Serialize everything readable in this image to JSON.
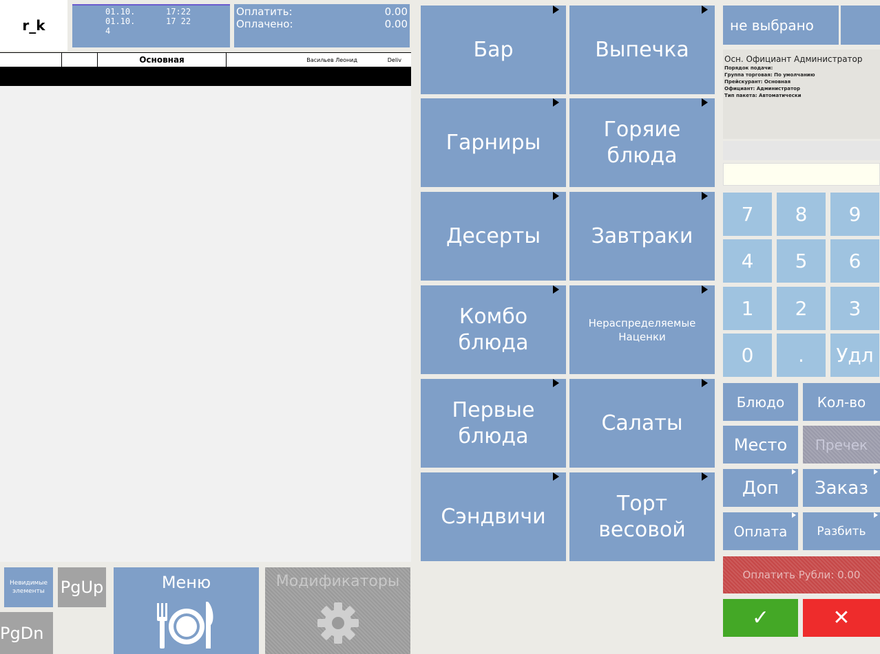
{
  "header": {
    "logo": "r_k",
    "dates": [
      {
        "date": "01.10.",
        "time": "17:22"
      },
      {
        "date": "01.10.",
        "time": "17 22"
      }
    ],
    "guests": "4",
    "to_pay_label": "Оплатить:",
    "to_pay_value": "0.00",
    "paid_label": "Оплачено:",
    "paid_value": "0.00"
  },
  "order_table": {
    "section": "Основная",
    "waiter": "Васильев Леонид",
    "type": "Deliv"
  },
  "bottom": {
    "invisible_label": "Невидимые элементы",
    "pgup": "PgUp",
    "pgdn": "PgDn",
    "menu": "Меню",
    "modifiers": "Модификаторы"
  },
  "categories": [
    {
      "label": "Бар"
    },
    {
      "label": "Выпечка"
    },
    {
      "label": "Гарниры"
    },
    {
      "label": "Горяие блюда"
    },
    {
      "label": "Десерты"
    },
    {
      "label": "Завтраки"
    },
    {
      "label": "Комбо блюда"
    },
    {
      "label": "Нераспределяемые Наценки"
    },
    {
      "label": "Первые блюда"
    },
    {
      "label": "Салаты"
    },
    {
      "label": "Сэндвичи"
    },
    {
      "label": "Торт весовой"
    }
  ],
  "right": {
    "not_selected": "не выбрано",
    "info_head": "Осн. Официант  Администратор",
    "info_lines": [
      "Порядок подачи:",
      "Группа торговая: По умолчанию",
      "Прейскурант: Основная",
      "Официант: Администратор",
      "Тип пакета: Автоматически"
    ],
    "keypad": [
      "7",
      "8",
      "9",
      "4",
      "5",
      "6",
      "1",
      "2",
      "3",
      "0",
      ".",
      "Удл"
    ],
    "actions": {
      "dish": "Блюдо",
      "qty": "Кол-во",
      "place": "Место",
      "precheck": "Пречек",
      "extra": "Доп",
      "order": "Заказ",
      "payment": "Оплата",
      "split": "Разбить"
    },
    "pay_rubles": "Оплатить Рубли: 0.00",
    "ok": "✓",
    "cancel": "✕"
  },
  "colors": {
    "tile": "#7f9fc8",
    "keypad": "#9fc3e0",
    "ok": "#44a826",
    "cancel": "#ee2c2c",
    "pay": "#c64848"
  }
}
